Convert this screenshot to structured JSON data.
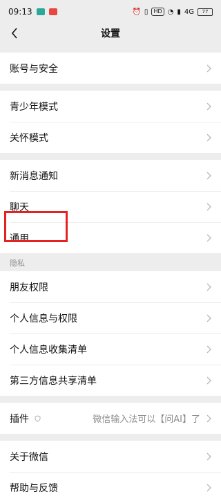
{
  "status": {
    "time": "09:13",
    "indicators": [
      "HD",
      "4G"
    ],
    "battery": "77"
  },
  "nav": {
    "title": "设置"
  },
  "groups": {
    "account": {
      "label": "账号与安全"
    },
    "youth": {
      "label": "青少年模式"
    },
    "care": {
      "label": "关怀模式"
    },
    "notify": {
      "label": "新消息通知"
    },
    "chat": {
      "label": "聊天"
    },
    "general": {
      "label": "通用"
    },
    "privacy_section": "隐私",
    "friends": {
      "label": "朋友权限"
    },
    "personal_info": {
      "label": "个人信息与权限"
    },
    "collect_list": {
      "label": "个人信息收集清单"
    },
    "third_party": {
      "label": "第三方信息共享清单"
    },
    "plugins": {
      "label": "插件",
      "hint": "微信输入法可以【问AI】了"
    },
    "about": {
      "label": "关于微信"
    },
    "help": {
      "label": "帮助与反馈"
    }
  },
  "colors": {
    "highlight": "#e52222",
    "background": "#ededed"
  }
}
